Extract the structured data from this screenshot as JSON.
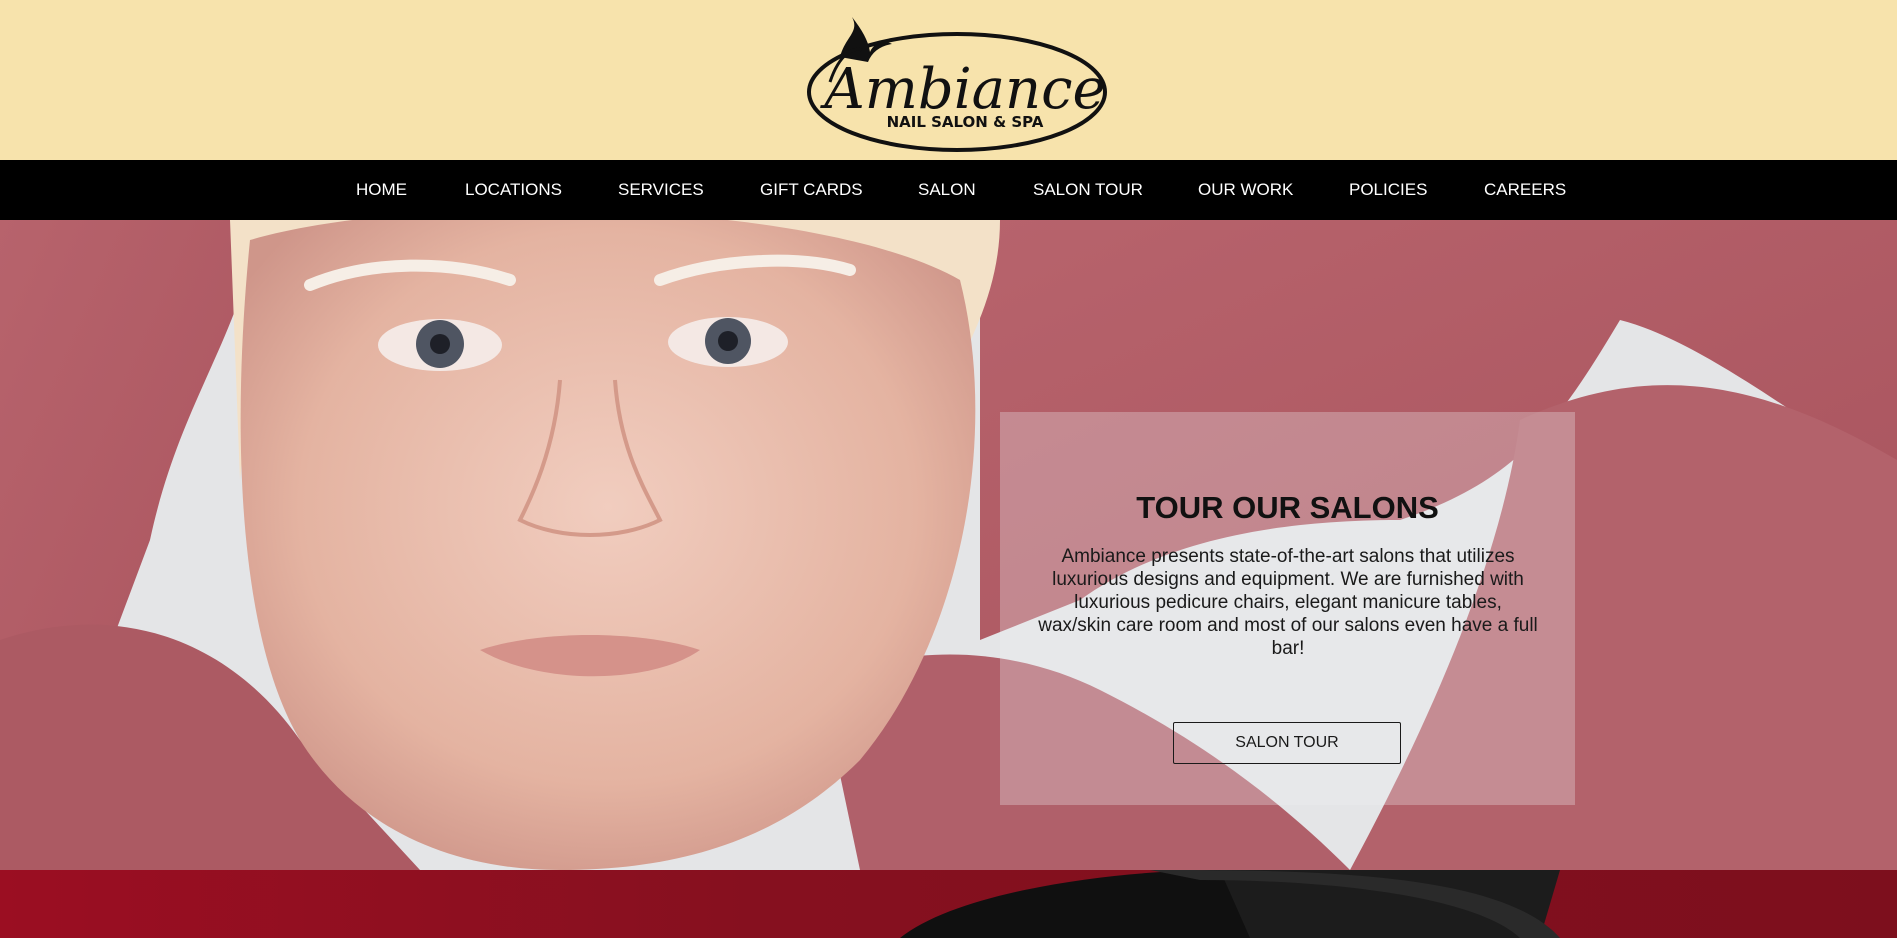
{
  "header": {
    "logo": {
      "brand": "Ambiance",
      "tagline": "NAIL SALON & SPA"
    }
  },
  "nav": {
    "items": [
      {
        "label": "HOME"
      },
      {
        "label": "LOCATIONS"
      },
      {
        "label": "SERVICES"
      },
      {
        "label": "GIFT CARDS"
      },
      {
        "label": "SALON"
      },
      {
        "label": "SALON TOUR"
      },
      {
        "label": "OUR WORK"
      },
      {
        "label": "POLICIES"
      },
      {
        "label": "CAREERS"
      }
    ]
  },
  "hero": {
    "title": "TOUR OUR SALONS",
    "body": "Ambiance presents state-of-the-art salons that utilizes luxurious designs and equipment. We are furnished with luxurious pedicure chairs, elegant manicure tables, wax/skin care room and most of our salons even have a full bar!",
    "button_label": "SALON TOUR"
  },
  "colors": {
    "header_bg": "#f7e3ac",
    "nav_bg": "#000000",
    "nav_text": "#ffffff",
    "band_red": "#8b0f20"
  }
}
